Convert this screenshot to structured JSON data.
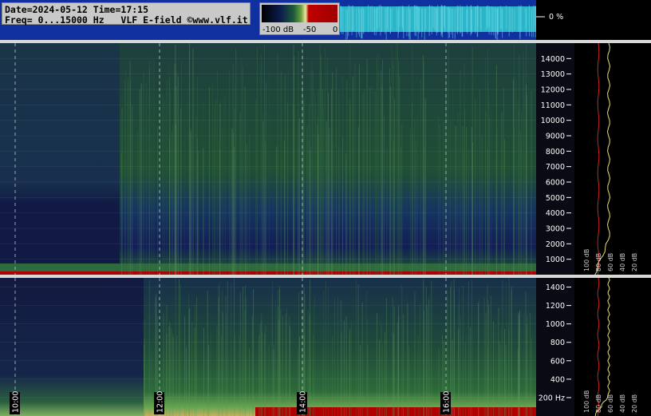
{
  "header": {
    "line1": "Date=2024-05-12 Time=17:15",
    "line2": "Freq= 0...15000 Hz   VLF E-field ©www.vlf.it"
  },
  "color_scale": {
    "labels": [
      "-100 dB",
      "-50",
      "0"
    ],
    "colors": [
      "#000000",
      "#0a1f4a",
      "#1d5a3a",
      "#6aa040",
      "#e8e8a0",
      "#c00000",
      "#a00000"
    ]
  },
  "top_strip": {
    "label": "0 %"
  },
  "colors": {
    "spectrogram_bg_low": "#10224e",
    "spectrogram_bg_high": "#1f4a35",
    "strip_blue": "#1030a0",
    "strip_cyan": "#2ab6c8",
    "separator": "#d8d8d8",
    "axis_text": "#ffffff",
    "profile_yellow": "#e8e070",
    "profile_red": "#d02020",
    "hot_red": "#b00000"
  },
  "chart_data": [
    {
      "type": "heatmap",
      "title": "",
      "ylabel": "Hz",
      "y_ticks": [
        "14000",
        "13000",
        "12000",
        "11000",
        "10000",
        "9000",
        "8000",
        "7000",
        "6000",
        "5000",
        "4000",
        "3000",
        "2000",
        "1000"
      ],
      "ylim": [
        0,
        15000
      ],
      "x_ticks": [
        "10:00",
        "12:00",
        "14:00",
        "16:00"
      ],
      "profile_labels": [
        "100 dB",
        "80 dB",
        "60 dB",
        "40 dB",
        "20 dB"
      ]
    },
    {
      "type": "heatmap",
      "title": "",
      "ylabel": "Hz",
      "y_ticks": [
        "1400",
        "1200",
        "1000",
        "800",
        "600",
        "400",
        "200 Hz"
      ],
      "ylim": [
        0,
        1500
      ],
      "x_ticks": [
        "10:00",
        "12:00",
        "14:00",
        "16:00"
      ],
      "profile_labels": [
        "100 dB",
        "80 dB",
        "60 dB",
        "40 dB",
        "20 dB"
      ]
    }
  ]
}
